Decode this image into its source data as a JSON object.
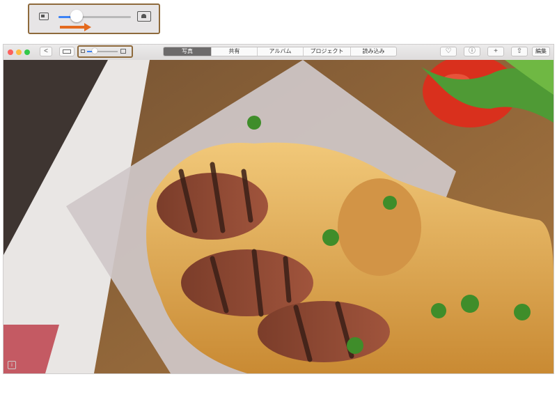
{
  "zoom_control": {
    "slider_level_percent": 25,
    "small_icon": "small-photo-icon",
    "large_icon": "large-photo-icon",
    "arrow_direction": "right"
  },
  "window": {
    "toolbar": {
      "back_glyph": "<",
      "tabs": [
        "写真",
        "共有",
        "アルバム",
        "プロジェクト",
        "読み込み"
      ],
      "active_tab": "写真",
      "heart_glyph": "♡",
      "info_glyph": "ⓘ",
      "add_glyph": "+",
      "share_glyph": "⇧",
      "edit_label": "編集",
      "zoom_slider_level_percent": 25
    },
    "photo": {
      "subject": "sausage bread",
      "corner_glyph": "i"
    }
  },
  "colors": {
    "accent": "#e46a1e",
    "callout_border": "#8e6a3c",
    "slider_fill": "#3b82f6",
    "active_tab": "#6d6b6b"
  }
}
